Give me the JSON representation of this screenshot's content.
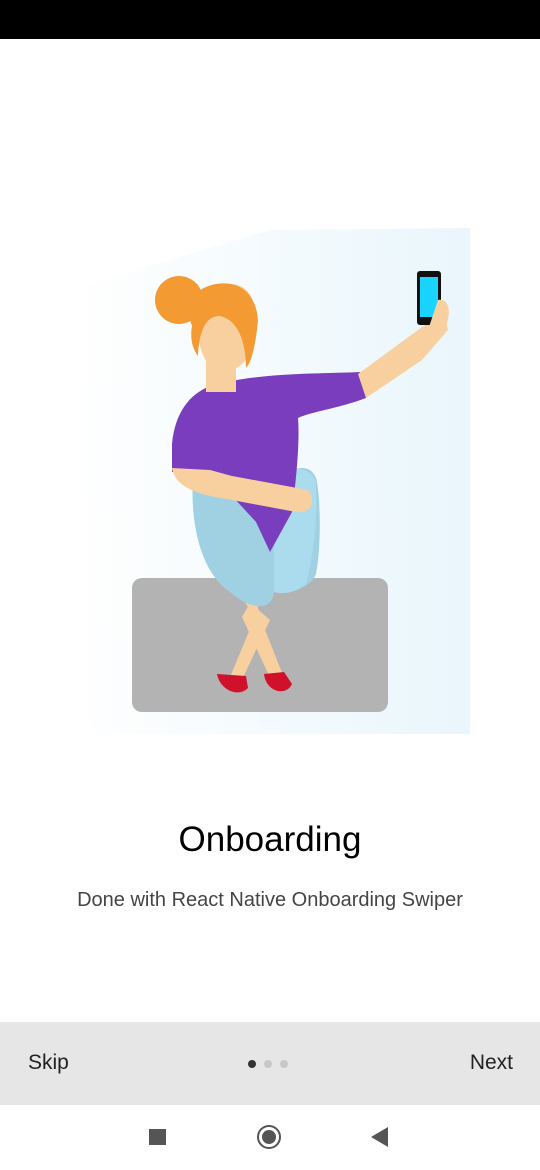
{
  "slide": {
    "title": "Onboarding",
    "subtitle": "Done with React Native Onboarding Swiper",
    "illustration": "woman-selfie-illustration"
  },
  "footer": {
    "skip_label": "Skip",
    "next_label": "Next",
    "page_index": 1,
    "page_count": 3
  },
  "system_nav": {
    "icons": [
      "recents-icon",
      "home-icon",
      "back-icon"
    ]
  },
  "colors": {
    "footer_bg": "#e6e6e6",
    "shirt": "#7a3dbd",
    "pants": "#9fd1e3",
    "hair": "#f39a32",
    "skin": "#f8d0a0",
    "shoes": "#d0112b",
    "bench": "#b3b3b3",
    "phone_screen": "#19d4ff"
  }
}
